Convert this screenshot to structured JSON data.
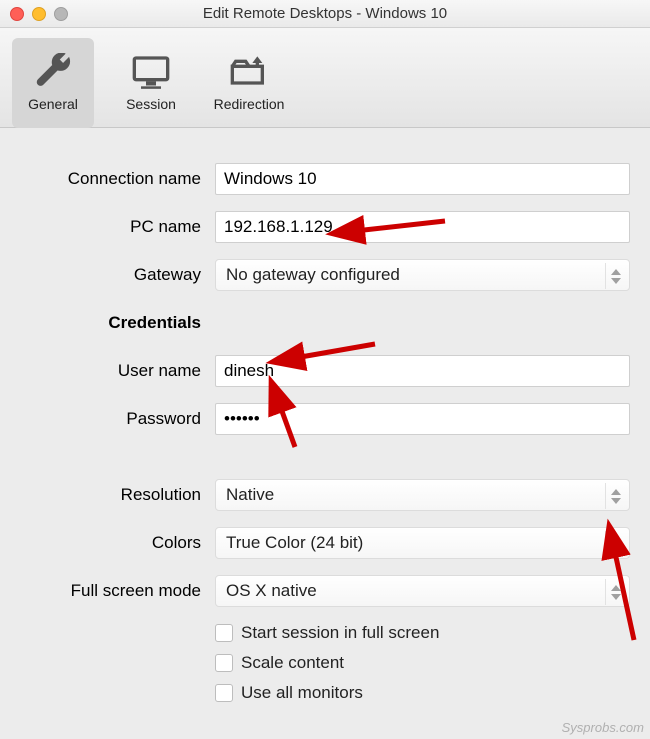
{
  "window_title": "Edit Remote Desktops - Windows 10",
  "toolbar": {
    "general": "General",
    "session": "Session",
    "redirection": "Redirection"
  },
  "form": {
    "connection_name_label": "Connection name",
    "connection_name_value": "Windows 10",
    "pc_name_label": "PC name",
    "pc_name_value": "192.168.1.129",
    "gateway_label": "Gateway",
    "gateway_value": "No gateway configured",
    "credentials_header": "Credentials",
    "user_name_label": "User name",
    "user_name_value": "dinesh",
    "password_label": "Password",
    "password_value": "••••••",
    "resolution_label": "Resolution",
    "resolution_value": "Native",
    "colors_label": "Colors",
    "colors_value": "True Color (24 bit)",
    "fullscreen_label": "Full screen mode",
    "fullscreen_value": "OS X native",
    "chk_start_full": "Start session in full screen",
    "chk_scale": "Scale content",
    "chk_monitors": "Use all monitors"
  },
  "watermark": "Sysprobs.com"
}
